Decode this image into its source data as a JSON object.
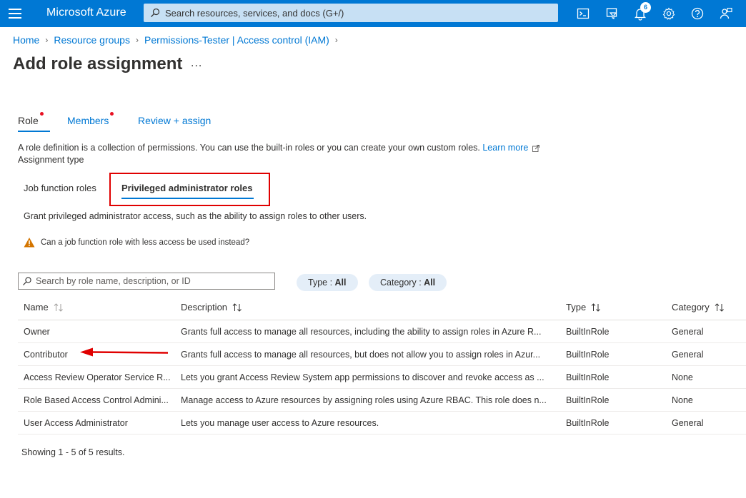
{
  "topbar": {
    "brand": "Microsoft Azure",
    "search_placeholder": "Search resources, services, and docs (G+/)",
    "notifications_count": "6"
  },
  "breadcrumb": [
    "Home",
    "Resource groups",
    "Permissions-Tester | Access control (IAM)"
  ],
  "page": {
    "title": "Add role assignment",
    "more": "..."
  },
  "tabs": [
    {
      "label": "Role",
      "required": true
    },
    {
      "label": "Members",
      "required": true
    },
    {
      "label": "Review + assign",
      "required": false
    }
  ],
  "description": {
    "text": "A role definition is a collection of permissions. You can use the built-in roles or you can create your own custom roles.",
    "link": "Learn more"
  },
  "assignment_type_label": "Assignment type",
  "subtabs": {
    "job": "Job function roles",
    "privileged": "Privileged administrator roles"
  },
  "grant_text": "Grant privileged administrator access, such as the ability to assign roles to other users.",
  "warning_text": "Can a job function role with less access be used instead?",
  "role_search_placeholder": "Search by role name, description, or ID",
  "filters": {
    "type_label": "Type : ",
    "type_value": "All",
    "category_label": "Category : ",
    "category_value": "All"
  },
  "table": {
    "headers": {
      "name": "Name",
      "description": "Description",
      "type": "Type",
      "category": "Category"
    },
    "rows": [
      {
        "name": "Owner",
        "description": "Grants full access to manage all resources, including the ability to assign roles in Azure R...",
        "type": "BuiltInRole",
        "category": "General"
      },
      {
        "name": "Contributor",
        "description": "Grants full access to manage all resources, but does not allow you to assign roles in Azur...",
        "type": "BuiltInRole",
        "category": "General"
      },
      {
        "name": "Access Review Operator Service R...",
        "description": "Lets you grant Access Review System app permissions to discover and revoke access as ...",
        "type": "BuiltInRole",
        "category": "None"
      },
      {
        "name": "Role Based Access Control Admini...",
        "description": "Manage access to Azure resources by assigning roles using Azure RBAC. This role does n...",
        "type": "BuiltInRole",
        "category": "None"
      },
      {
        "name": "User Access Administrator",
        "description": "Lets you manage user access to Azure resources.",
        "type": "BuiltInRole",
        "category": "General"
      }
    ]
  },
  "footer": "Showing 1 - 5 of 5 results.",
  "colors": {
    "accent": "#0078d4",
    "highlight": "#e00000",
    "required_dot": "#e81123",
    "warning": "#d47500"
  }
}
